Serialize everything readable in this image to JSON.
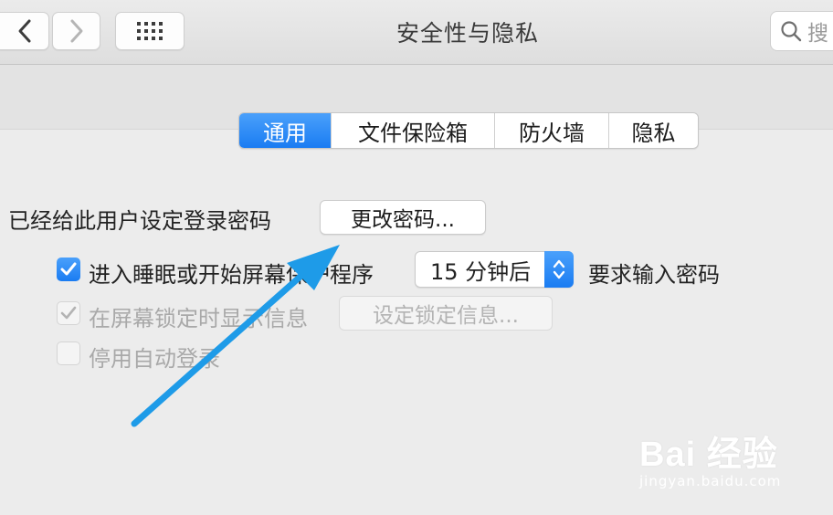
{
  "window": {
    "title": "安全性与隐私"
  },
  "toolbar": {
    "search_text": "搜"
  },
  "tabs": [
    {
      "label": "通用",
      "active": true
    },
    {
      "label": "文件保险箱",
      "active": false
    },
    {
      "label": "防火墙",
      "active": false
    },
    {
      "label": "隐私",
      "active": false
    }
  ],
  "general": {
    "password_set_label": "已经给此用户设定登录密码",
    "change_password_button": "更改密码...",
    "require_password": {
      "checked": true,
      "label_before": "进入睡眠或开始屏幕保护程序",
      "delay_value": "15 分钟后",
      "label_after": "要求输入密码"
    },
    "show_message": {
      "checked": true,
      "enabled": false,
      "label": "在屏幕锁定时显示信息",
      "button": "设定锁定信息..."
    },
    "disable_auto_login": {
      "checked": false,
      "enabled": false,
      "label": "停用自动登录"
    }
  },
  "watermark": {
    "main": "Bai 经验",
    "sub": "jingyan.baidu.com"
  },
  "colors": {
    "accent": "#1a7cf2",
    "arrow": "#1e9be8"
  }
}
